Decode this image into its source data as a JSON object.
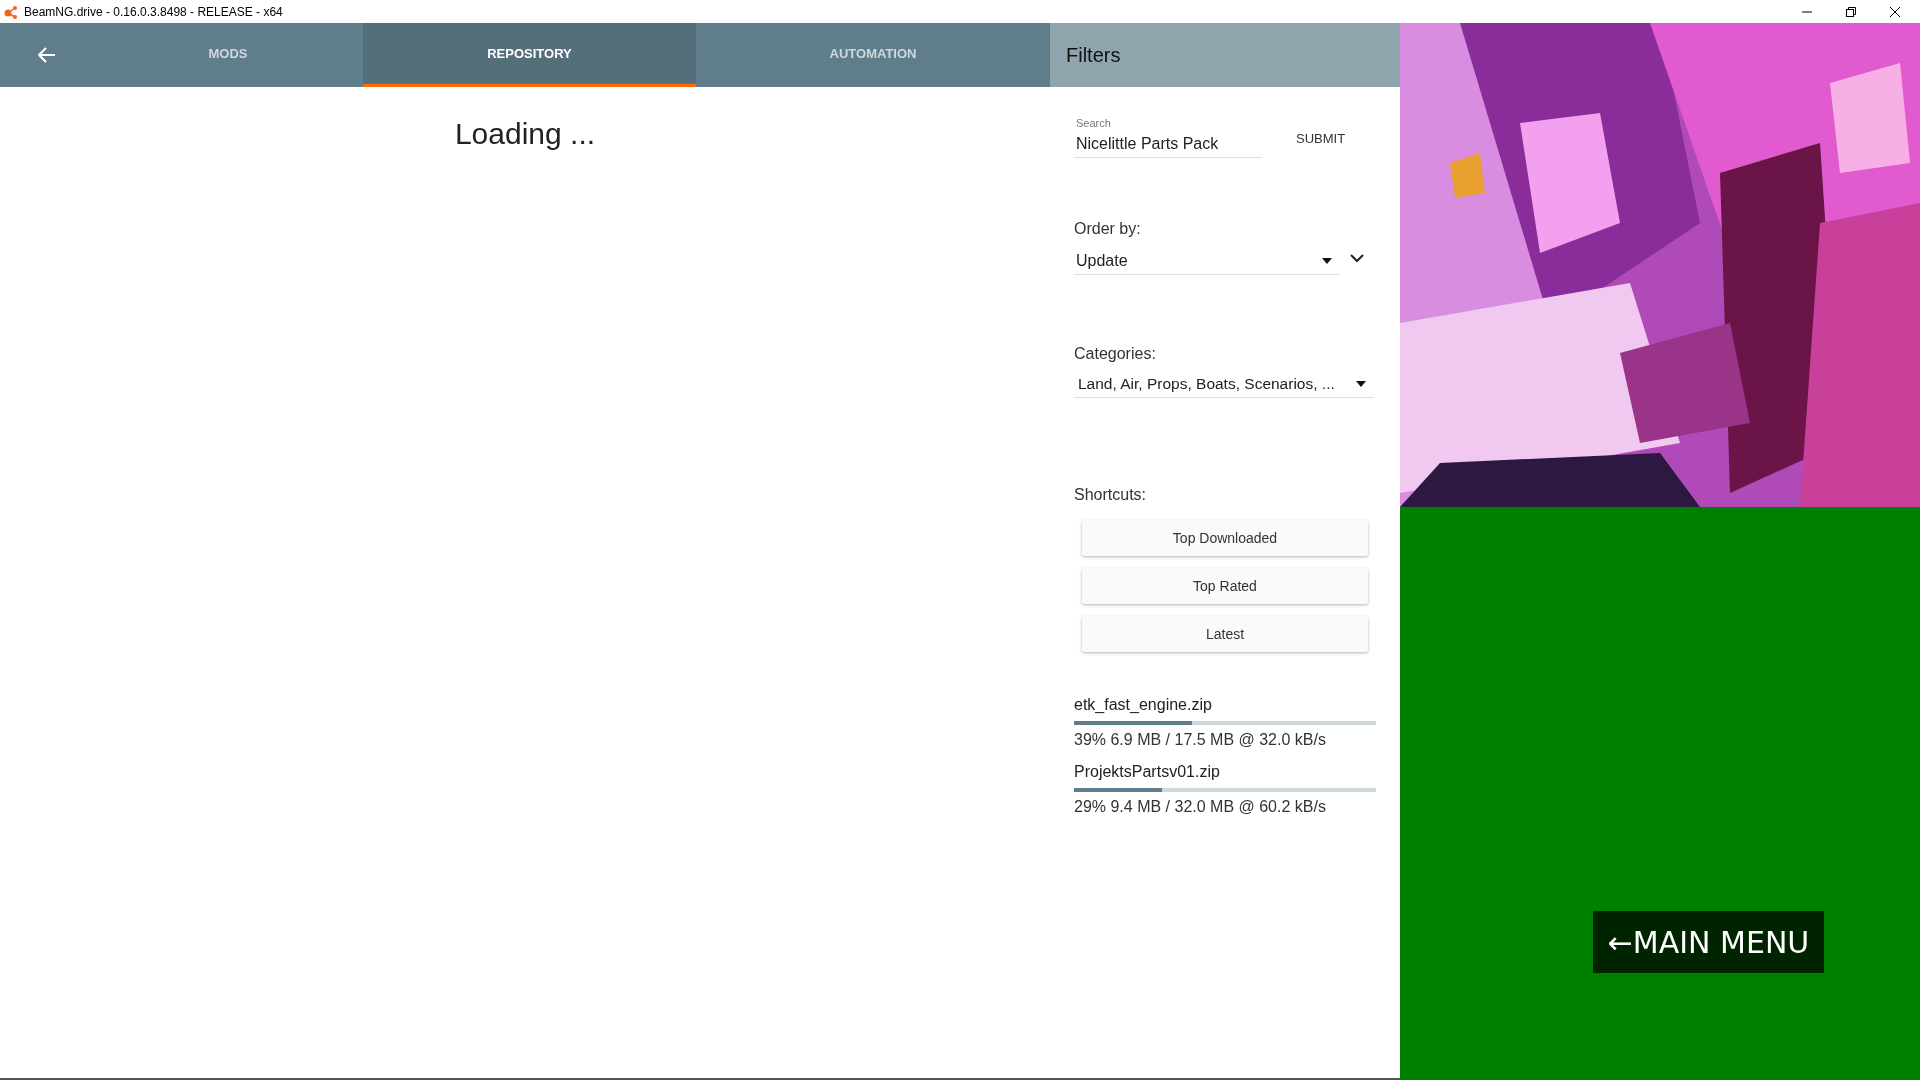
{
  "window": {
    "title": "BeamNG.drive - 0.16.0.3.8498 - RELEASE - x64"
  },
  "tabs": [
    {
      "label": "MODS",
      "selected": false
    },
    {
      "label": "REPOSITORY",
      "selected": true
    },
    {
      "label": "AUTOMATION",
      "selected": false
    }
  ],
  "content": {
    "status": "Loading ..."
  },
  "filters": {
    "title": "Filters",
    "search": {
      "label": "Search",
      "value": "Nicelittle Parts Pack",
      "button": "SUBMIT"
    },
    "order": {
      "label": "Order by:",
      "value": "Update"
    },
    "categories": {
      "label": "Categories:",
      "value": "Land, Air, Props, Boats, Scenarios, ..."
    },
    "shortcuts": {
      "label": "Shortcuts:",
      "buttons": [
        "Top Downloaded",
        "Top Rated",
        "Latest"
      ]
    },
    "downloads": [
      {
        "name": "etk_fast_engine.zip",
        "level": 0.39,
        "progress": "39% 6.9 MB / 17.5 MB @ 32.0 kB/s"
      },
      {
        "name": "ProjektsPartsv01.zip",
        "level": 0.29,
        "progress": "29% 9.4 MB / 32.0 MB @ 60.2 kB/s"
      }
    ]
  },
  "main_menu_button": {
    "label": "←MAIN MENU"
  }
}
